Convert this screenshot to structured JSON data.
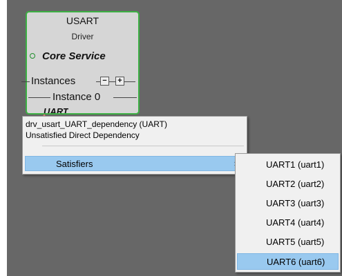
{
  "component": {
    "title": "USART",
    "subtitle": "Driver",
    "service_label": "Core Service",
    "instances_label": "Instances",
    "remove_instance_symbol": "−",
    "add_instance_symbol": "+",
    "instance_label": "Instance 0",
    "instance_name": "UART",
    "border_color": "#3cb043",
    "status_color": "#1f8f2c"
  },
  "context_menu": {
    "dependency_title": "drv_usart_UART_dependency (UART)",
    "dependency_status": "Unsatisfied Direct Dependency",
    "satisfiers_label": "Satisfiers",
    "submenu_arrow": "›"
  },
  "submenu": {
    "items": [
      {
        "label": "UART1 (uart1)",
        "selected": false
      },
      {
        "label": "UART2 (uart2)",
        "selected": false
      },
      {
        "label": "UART3 (uart3)",
        "selected": false
      },
      {
        "label": "UART4 (uart4)",
        "selected": false
      },
      {
        "label": "UART5 (uart5)",
        "selected": false
      },
      {
        "label": "UART6 (uart6)",
        "selected": true
      }
    ],
    "highlight_color": "#99c9ef"
  }
}
